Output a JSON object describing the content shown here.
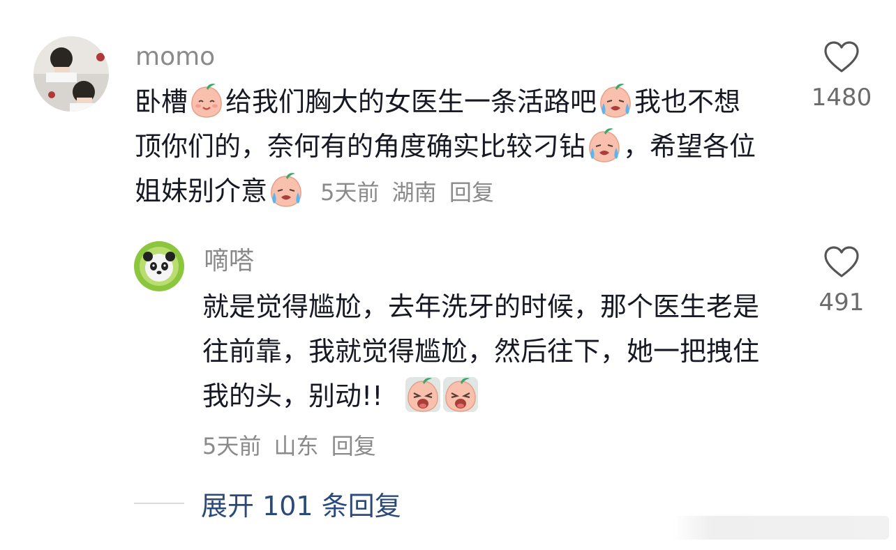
{
  "comments": [
    {
      "username": "momo",
      "text": [
        {
          "type": "text",
          "value": "卧槽"
        },
        {
          "type": "emoji",
          "name": "smile-peach-emoji"
        },
        {
          "type": "text",
          "value": "给我们胸大的女医生一条活路吧"
        },
        {
          "type": "emoji",
          "name": "crying-peach-emoji"
        },
        {
          "type": "text",
          "value": "我也不想顶你们的，奈何有的角度确实比较刁钻"
        },
        {
          "type": "emoji",
          "name": "crying-peach-emoji"
        },
        {
          "type": "text",
          "value": "，希望各位姐妹别介意"
        },
        {
          "type": "emoji",
          "name": "crying-peach-emoji"
        }
      ],
      "time": "5天前",
      "location": "湖南",
      "reply_label": "回复",
      "likes": "1480"
    },
    {
      "username": "嘀嗒",
      "text": [
        {
          "type": "text",
          "value": "就是觉得尴尬，去年洗牙的时候，那个医生老是往前靠，我就觉得尴尬，然后往下，她一把拽住我的头，别动!!"
        },
        {
          "type": "emoji",
          "name": "shouting-peach-emoji"
        },
        {
          "type": "emoji",
          "name": "shouting-peach-emoji"
        }
      ],
      "time": "5天前",
      "location": "山东",
      "reply_label": "回复",
      "likes": "491"
    }
  ],
  "expand_replies": {
    "label": "展开 101 条回复"
  },
  "colors": {
    "username": "#8a8a8a",
    "text": "#161823",
    "meta": "#8a8a8a",
    "expand": "#2b4a7a",
    "heart_stroke": "#555555"
  }
}
